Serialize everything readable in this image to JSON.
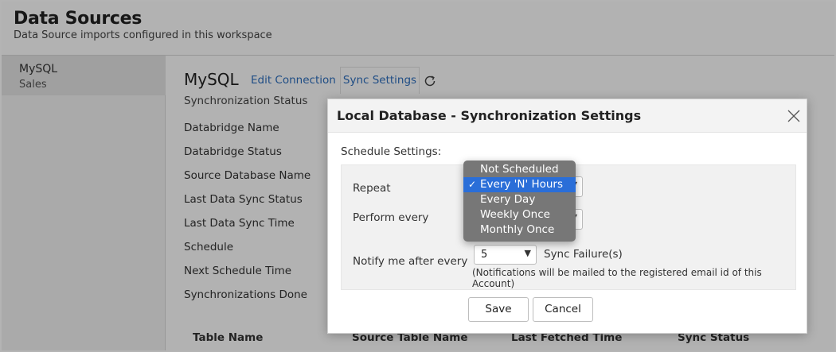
{
  "header": {
    "title": "Data Sources",
    "subtitle": "Data Source imports configured in this workspace"
  },
  "sidebar": {
    "items": [
      {
        "name": "MySQL",
        "sub": "Sales"
      }
    ]
  },
  "main": {
    "title": "MySQL",
    "edit_link": "Edit Connection",
    "sync_tab": "Sync Settings",
    "sync_status_label": "Synchronization Status",
    "properties": [
      "Databridge Name",
      "Databridge Status",
      "Source Database Name",
      "Last Data Sync Status",
      "Last Data Sync Time",
      "Schedule",
      "Next Schedule Time",
      "Synchronizations Done"
    ],
    "table_headers": [
      "Table Name",
      "Source Table Name",
      "Last Fetched Time",
      "Sync Status"
    ]
  },
  "dialog": {
    "title": "Local Database - Synchronization Settings",
    "schedule_label": "Schedule Settings:",
    "repeat_label": "Repeat",
    "perform_label": "Perform every",
    "notify_label": "Notify me after every",
    "notify_value": "5",
    "failure_label": "Sync Failure(s)",
    "note": "(Notifications will be mailed to the registered email id of this Account)",
    "save": "Save",
    "cancel": "Cancel"
  },
  "repeat_dropdown": {
    "options": [
      "Not Scheduled",
      "Every 'N' Hours",
      "Every Day",
      "Weekly Once",
      "Monthly Once"
    ],
    "selected": "Every 'N' Hours",
    "check": "✓"
  },
  "colors": {
    "link": "#2d6fbf",
    "dropdown_bg": "#777777",
    "dropdown_selected": "#2a6ed8"
  }
}
